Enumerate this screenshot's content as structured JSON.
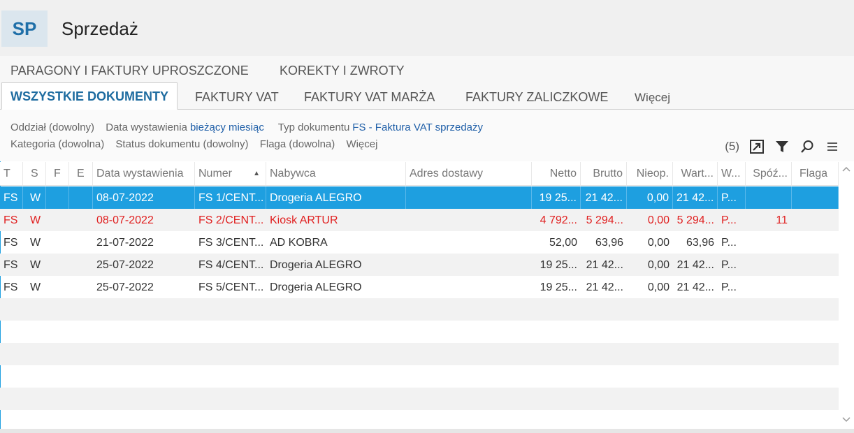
{
  "app": {
    "badge": "SP",
    "title": "Sprzedaż"
  },
  "tabs_row1": [
    "PARAGONY I FAKTURY UPROSZCZONE",
    "KOREKTY I ZWROTY"
  ],
  "tabs_row2": [
    {
      "label": "WSZYSTKIE DOKUMENTY",
      "active": true
    },
    {
      "label": "FAKTURY VAT"
    },
    {
      "label": "FAKTURY VAT MARŻA"
    },
    {
      "label": "FAKTURY ZALICZKOWE"
    },
    {
      "label": "Więcej"
    }
  ],
  "filters": {
    "oddzial": "Oddział (dowolny)",
    "data_label": "Data wystawienia",
    "data_value": "bieżący miesiąc",
    "typ_label": "Typ dokumentu",
    "typ_value": "FS - Faktura VAT sprzedaży",
    "kategoria": "Kategoria (dowolna)",
    "status": "Status dokumentu (dowolny)",
    "flaga": "Flaga (dowolna)",
    "wiecej": "Więcej"
  },
  "toolbar": {
    "count": "(5)"
  },
  "columns": [
    "T",
    "S",
    "F",
    "E",
    "Data wystawienia",
    "Numer",
    "Nabywca",
    "Adres dostawy",
    "Netto",
    "Brutto",
    "Nieop.",
    "Wart...",
    "W...",
    "Spóź...",
    "Flaga"
  ],
  "rows": [
    {
      "t": "FS",
      "s": "W",
      "f": "",
      "e": "",
      "date": "08-07-2022",
      "num": "FS 1/CENT...",
      "buyer": "Drogeria ALEGRO",
      "addr": "",
      "netto": "19 25...",
      "brutto": "21 42...",
      "nieop": "0,00",
      "wart": "21 42...",
      "w": "P...",
      "spoz": "",
      "flaga": ""
    },
    {
      "t": "FS",
      "s": "W",
      "f": "",
      "e": "",
      "date": "08-07-2022",
      "num": "FS 2/CENT...",
      "buyer": "Kiosk ARTUR",
      "addr": "",
      "netto": "4 792...",
      "brutto": "5 294...",
      "nieop": "0,00",
      "wart": "5 294...",
      "w": "P...",
      "spoz": "11",
      "flaga": ""
    },
    {
      "t": "FS",
      "s": "W",
      "f": "",
      "e": "",
      "date": "21-07-2022",
      "num": "FS 3/CENT...",
      "buyer": "AD KOBRA",
      "addr": "",
      "netto": "52,00",
      "brutto": "63,96",
      "nieop": "0,00",
      "wart": "63,96",
      "w": "P...",
      "spoz": "",
      "flaga": ""
    },
    {
      "t": "FS",
      "s": "W",
      "f": "",
      "e": "",
      "date": "25-07-2022",
      "num": "FS 4/CENT...",
      "buyer": "Drogeria ALEGRO",
      "addr": "",
      "netto": "19 25...",
      "brutto": "21 42...",
      "nieop": "0,00",
      "wart": "21 42...",
      "w": "P...",
      "spoz": "",
      "flaga": ""
    },
    {
      "t": "FS",
      "s": "W",
      "f": "",
      "e": "",
      "date": "25-07-2022",
      "num": "FS 5/CENT...",
      "buyer": "Drogeria ALEGRO",
      "addr": "",
      "netto": "19 25...",
      "brutto": "21 42...",
      "nieop": "0,00",
      "wart": "21 42...",
      "w": "P...",
      "spoz": "",
      "flaga": ""
    }
  ],
  "colors": {
    "accent": "#1e9fe0",
    "link": "#1f5fa8",
    "overdue": "#e01f1f"
  }
}
